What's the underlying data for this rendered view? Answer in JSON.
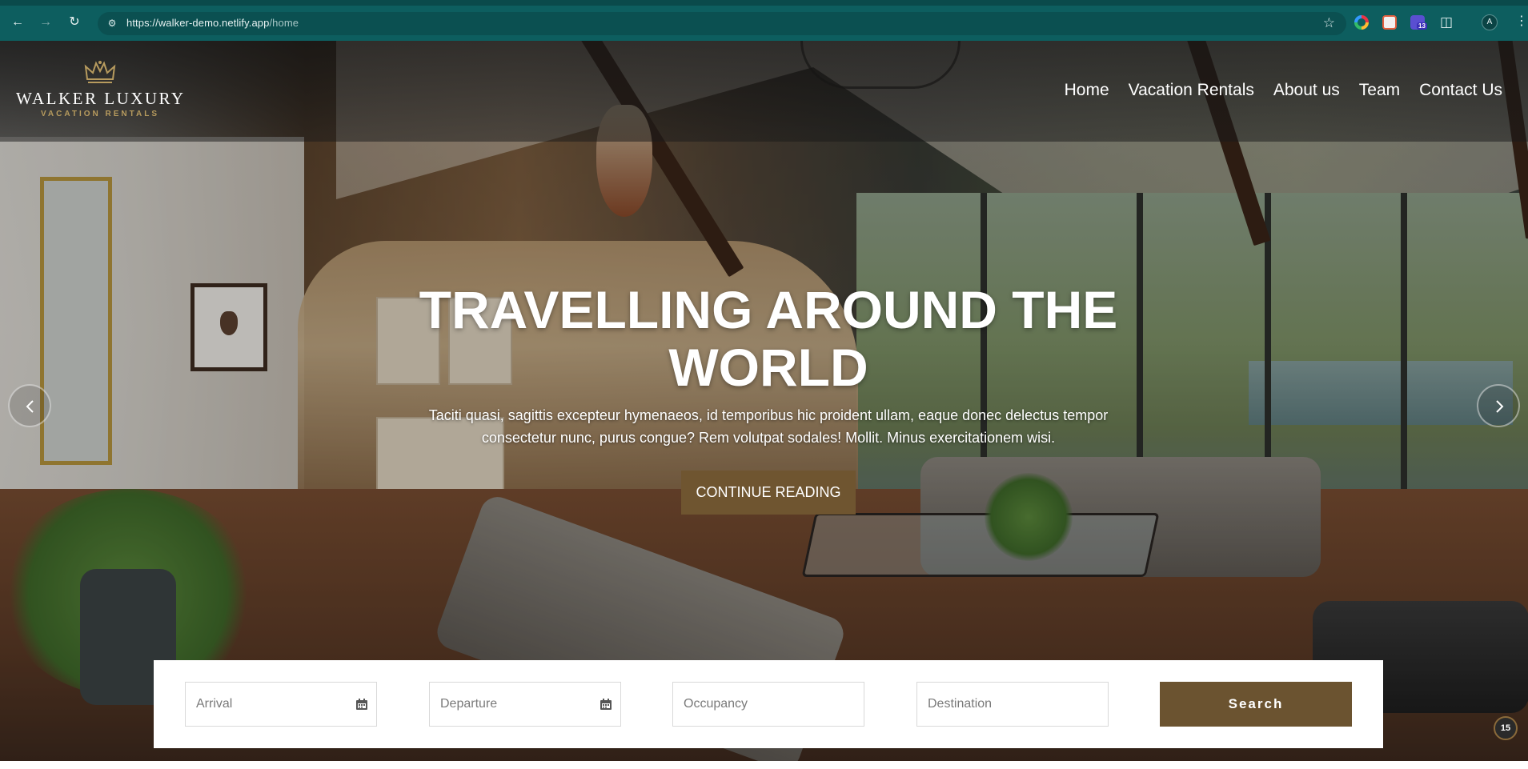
{
  "browser": {
    "url_host": "https://walker-demo.netlify.app",
    "url_path": "/home",
    "profile_initial": "A",
    "extension_badge": "13"
  },
  "site": {
    "logo_name": "WALKER LUXURY",
    "logo_sub": "VACATION RENTALS",
    "nav": [
      {
        "label": "Home"
      },
      {
        "label": "Vacation Rentals"
      },
      {
        "label": "About us"
      },
      {
        "label": "Team"
      },
      {
        "label": "Contact Us"
      }
    ]
  },
  "hero": {
    "title": "TRAVELLING AROUND THE WORLD",
    "text": "Taciti quasi, sagittis excepteur hymenaeos, id temporibus hic proident ullam, eaque donec delectus tempor consectetur nunc, purus congue? Rem volutpat sodales! Mollit. Minus exercitationem wisi.",
    "cta_label": "CONTINUE READING"
  },
  "search": {
    "arrival_placeholder": "Arrival",
    "departure_placeholder": "Departure",
    "occupancy_placeholder": "Occupancy",
    "destination_placeholder": "Destination",
    "button_label": "Search"
  },
  "chat_badge": "15",
  "colors": {
    "chrome_bg": "#0d5e5f",
    "brand_gold": "#b79b5e",
    "button_brown": "#6b5330"
  },
  "icons": [
    "back-icon",
    "forward-icon",
    "reload-icon",
    "site-info-icon",
    "bookmark-star-icon",
    "extensions-icon",
    "more-menu-icon",
    "crown-logo-icon",
    "chevron-left-icon",
    "chevron-right-icon",
    "calendar-icon"
  ]
}
